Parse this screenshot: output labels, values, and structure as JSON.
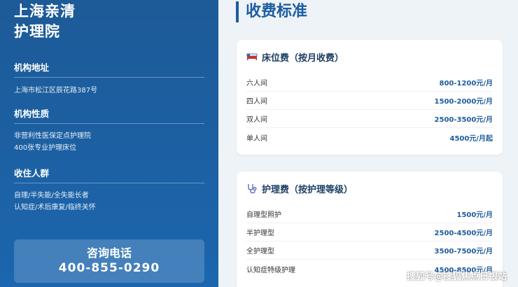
{
  "sidebar": {
    "org_name_line1": "上海亲清",
    "org_name_line2": "护理院",
    "sections": [
      {
        "title": "机构地址",
        "lines": [
          "上海市松江区辰花路387号"
        ]
      },
      {
        "title": "机构性质",
        "lines": [
          "非营利性医保定点护理院",
          "400张专业护理床位"
        ]
      },
      {
        "title": "收住人群",
        "lines": [
          "自理/半失能/全失能长者",
          "认知症/术后康复/临终关怀"
        ]
      }
    ],
    "contact": {
      "label": "咨询电话",
      "phone": "400-855-0290"
    }
  },
  "main": {
    "title": "收费标准",
    "bed_card": {
      "icon": "bed-icon",
      "title": "床位费（按月收费）",
      "rows": [
        {
          "name": "六人间",
          "price": "800-1200元/月"
        },
        {
          "name": "四人间",
          "price": "1500-2000元/月"
        },
        {
          "name": "双人间",
          "price": "2500-3500元/月"
        },
        {
          "name": "单人间",
          "price": "4500元/月起"
        }
      ]
    },
    "care_card": {
      "icon": "stethoscope-icon",
      "title": "护理费（按护理等级）",
      "rows": [
        {
          "name": "自理型照护",
          "price": "1500元/月"
        },
        {
          "name": "半护理型",
          "price": "2500-4500元/月"
        },
        {
          "name": "全护理型",
          "price": "3500-7500元/月"
        },
        {
          "name": "认知症特级护理",
          "price": "4500-8500元/月"
        }
      ]
    }
  },
  "watermark": "搜狐号@搜狐焦点日银站",
  "colors": {
    "sidebar": "#1d5a97",
    "accent": "#1c5c9f",
    "background": "#eef3f8"
  }
}
